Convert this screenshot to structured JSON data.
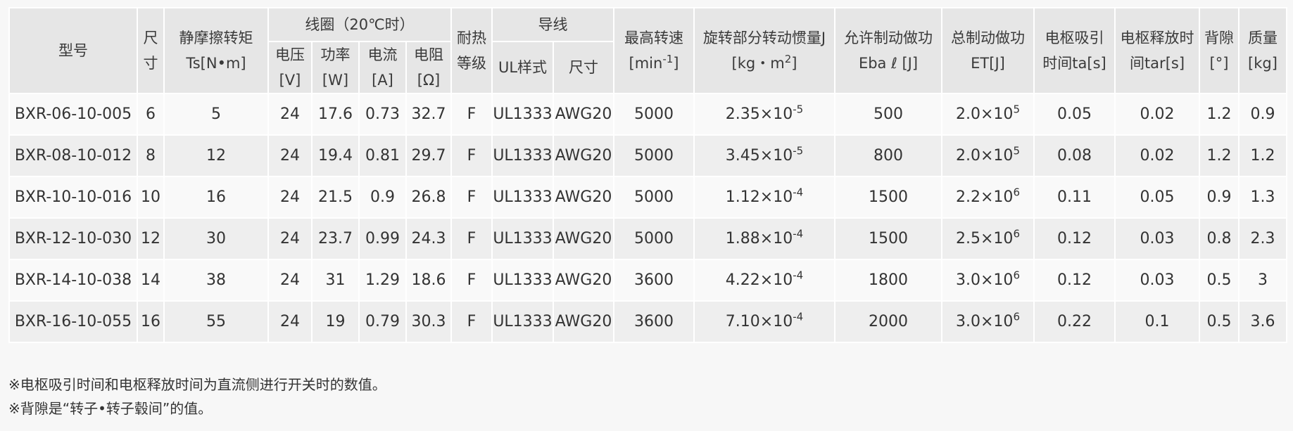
{
  "headers": {
    "model": "型号",
    "size": "尺寸",
    "torque_l1": "静摩擦转矩",
    "torque_l2": "Ts[N•m]",
    "coil": "线圈（20℃时）",
    "voltage_l1": "电压",
    "voltage_l2": "[V]",
    "power_l1": "功率",
    "power_l2": "[W]",
    "current_l1": "电流",
    "current_l2": "[A]",
    "resistance_l1": "电阻",
    "resistance_l2": "[Ω]",
    "heat_class": "耐热等级",
    "wire": "导线",
    "ul_style": "UL样式",
    "wire_size": "尺寸",
    "max_speed_l1": "最高转速",
    "max_speed_l2": "[min",
    "max_speed_exp": "-1",
    "max_speed_l2_end": "]",
    "inertia_l1": "旋转部分转动惯量J",
    "inertia_l2": "[kg・m",
    "inertia_exp": "2",
    "inertia_l2_end": "]",
    "allow_work_l1": "允许制动做功",
    "allow_work_l2": "Eba ℓ [J]",
    "total_work_l1": "总制动做功",
    "total_work_l2": "ET[J]",
    "attract_l1": "电枢吸引",
    "attract_l2": "时间ta[s]",
    "release_l1": "电枢释放时",
    "release_l2": "间tar[s]",
    "backlash_l1": "背隙",
    "backlash_l2": "[°]",
    "mass_l1": "质量",
    "mass_l2": "[kg]"
  },
  "rows": [
    {
      "model": "BXR-06-10-005",
      "size": "6",
      "torque": "5",
      "voltage": "24",
      "power": "17.6",
      "current": "0.73",
      "resistance": "32.7",
      "heat": "F",
      "ul": "UL1333",
      "awg": "AWG20",
      "speed": "5000",
      "inertia_base": "2.35×10",
      "inertia_exp": "-5",
      "allow": "500",
      "total_base": "2.0×10",
      "total_exp": "5",
      "ta": "0.05",
      "tar": "0.02",
      "backlash": "1.2",
      "mass": "0.9"
    },
    {
      "model": "BXR-08-10-012",
      "size": "8",
      "torque": "12",
      "voltage": "24",
      "power": "19.4",
      "current": "0.81",
      "resistance": "29.7",
      "heat": "F",
      "ul": "UL1333",
      "awg": "AWG20",
      "speed": "5000",
      "inertia_base": "3.45×10",
      "inertia_exp": "-5",
      "allow": "800",
      "total_base": "2.0×10",
      "total_exp": "5",
      "ta": "0.08",
      "tar": "0.02",
      "backlash": "1.2",
      "mass": "1.2"
    },
    {
      "model": "BXR-10-10-016",
      "size": "10",
      "torque": "16",
      "voltage": "24",
      "power": "21.5",
      "current": "0.9",
      "resistance": "26.8",
      "heat": "F",
      "ul": "UL1333",
      "awg": "AWG20",
      "speed": "5000",
      "inertia_base": "1.12×10",
      "inertia_exp": "-4",
      "allow": "1500",
      "total_base": "2.2×10",
      "total_exp": "6",
      "ta": "0.11",
      "tar": "0.05",
      "backlash": "0.9",
      "mass": "1.3"
    },
    {
      "model": "BXR-12-10-030",
      "size": "12",
      "torque": "30",
      "voltage": "24",
      "power": "23.7",
      "current": "0.99",
      "resistance": "24.3",
      "heat": "F",
      "ul": "UL1333",
      "awg": "AWG20",
      "speed": "5000",
      "inertia_base": "1.88×10",
      "inertia_exp": "-4",
      "allow": "1500",
      "total_base": "2.5×10",
      "total_exp": "6",
      "ta": "0.12",
      "tar": "0.03",
      "backlash": "0.8",
      "mass": "2.3"
    },
    {
      "model": "BXR-14-10-038",
      "size": "14",
      "torque": "38",
      "voltage": "24",
      "power": "31",
      "current": "1.29",
      "resistance": "18.6",
      "heat": "F",
      "ul": "UL1333",
      "awg": "AWG20",
      "speed": "3600",
      "inertia_base": "4.22×10",
      "inertia_exp": "-4",
      "allow": "1800",
      "total_base": "3.0×10",
      "total_exp": "6",
      "ta": "0.12",
      "tar": "0.03",
      "backlash": "0.5",
      "mass": "3"
    },
    {
      "model": "BXR-16-10-055",
      "size": "16",
      "torque": "55",
      "voltage": "24",
      "power": "19",
      "current": "0.79",
      "resistance": "30.3",
      "heat": "F",
      "ul": "UL1333",
      "awg": "AWG20",
      "speed": "3600",
      "inertia_base": "7.10×10",
      "inertia_exp": "-4",
      "allow": "2000",
      "total_base": "3.0×10",
      "total_exp": "6",
      "ta": "0.22",
      "tar": "0.1",
      "backlash": "0.5",
      "mass": "3.6"
    }
  ],
  "notes": [
    "※电枢吸引时间和电枢释放时间为直流侧进行开关时的数值。",
    "※背隙是“转子•转子毂间”的值。"
  ]
}
